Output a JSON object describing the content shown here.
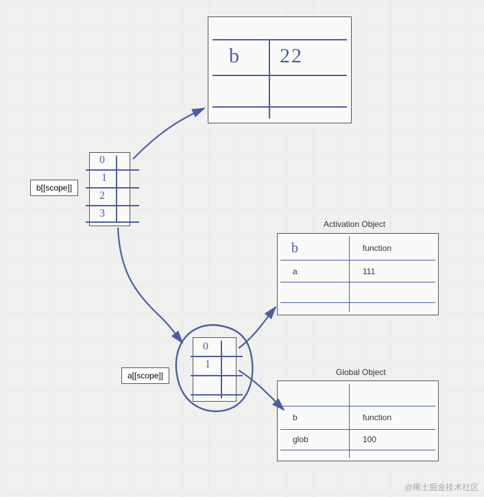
{
  "labels": {
    "b_scope": "b[[scope]]",
    "a_scope": "a[[scope]]"
  },
  "top_table": {
    "key": "b",
    "value": "22"
  },
  "b_mini": {
    "indices": [
      "0",
      "1",
      "2",
      "3"
    ]
  },
  "a_mini": {
    "indices": [
      "0",
      "1"
    ]
  },
  "activation_object": {
    "title": "Activation Object",
    "rows": [
      {
        "key": "b",
        "value": "function"
      },
      {
        "key": "a",
        "value": "111"
      }
    ]
  },
  "global_object": {
    "title": "Global Object",
    "rows": [
      {
        "key": "b",
        "value": "function"
      },
      {
        "key": "glob",
        "value": "100"
      }
    ]
  },
  "colors": {
    "ink": "#4a5ea3",
    "border": "#555555",
    "paper": "#fafaf9"
  },
  "watermark": "@稀土掘金技术社区"
}
